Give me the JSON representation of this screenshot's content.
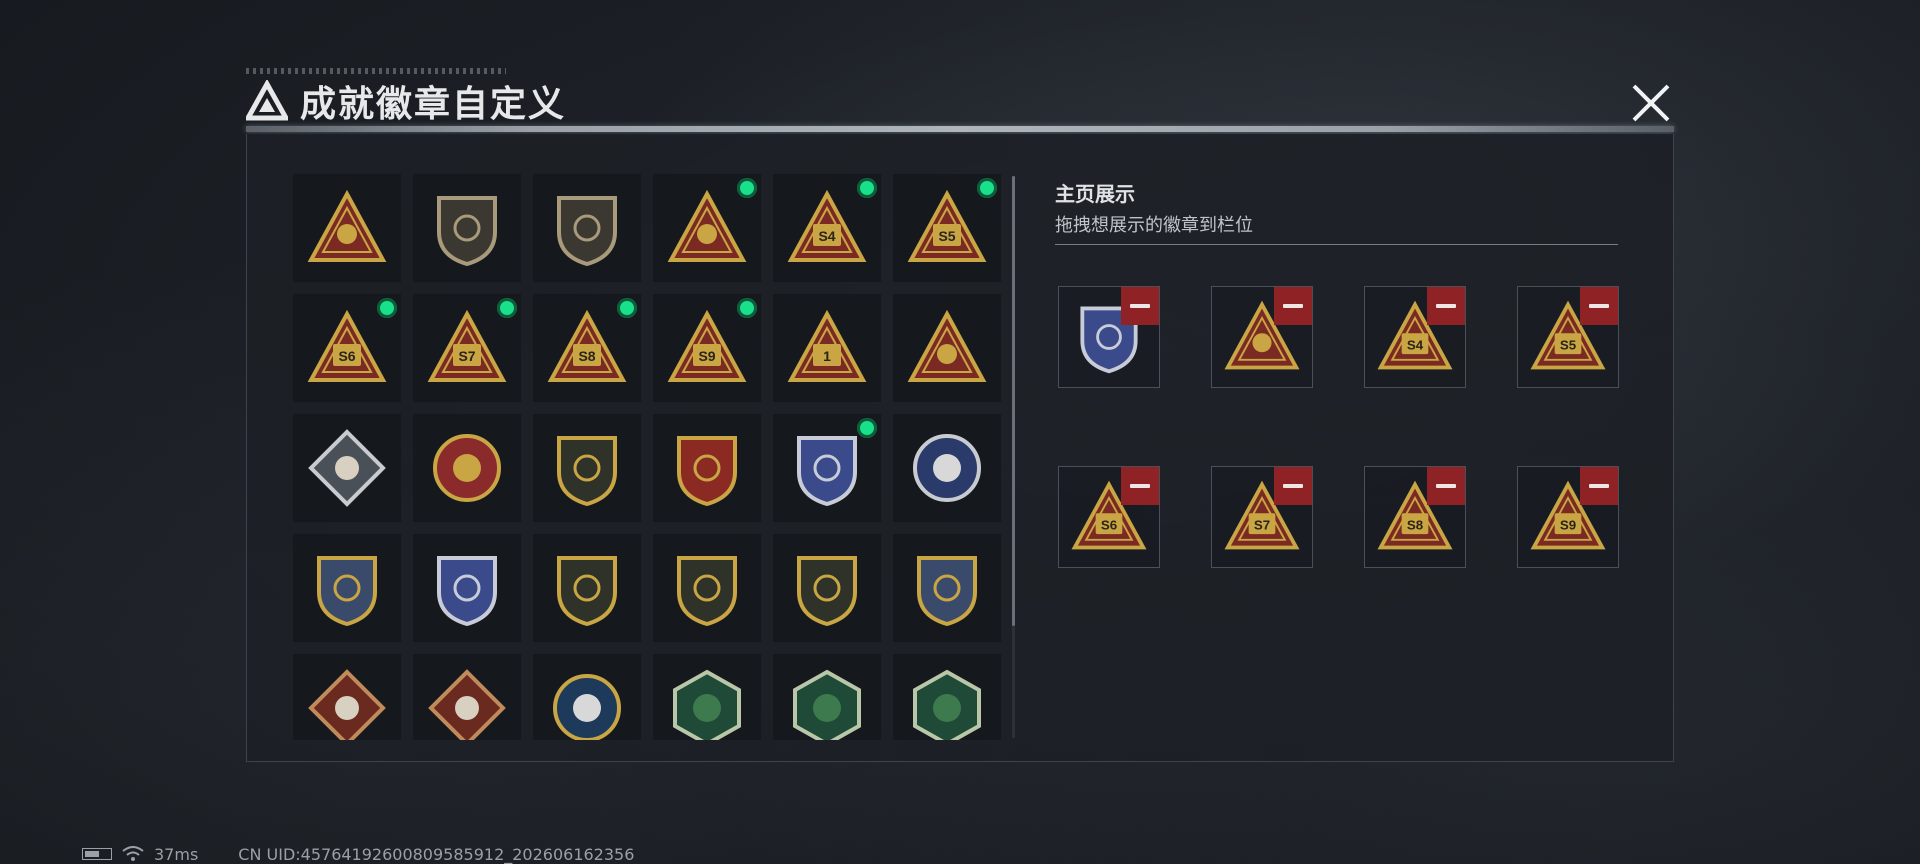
{
  "header": {
    "title": "成就徽章自定义"
  },
  "colors": {
    "accent_gold": "#c9a544",
    "brand_red": "#8f2225",
    "equipped_dot": "#19e08a",
    "badge_blue": "#3a4a8a"
  },
  "badge_library": {
    "rows": [
      [
        {
          "icon": "triangle-logo-shield-badge",
          "equipped": false
        },
        {
          "icon": "helicopter-shield-badge",
          "equipped": false
        },
        {
          "icon": "diamond-emblem-shield-badge",
          "equipped": false
        },
        {
          "icon": "radar-dish-triangle-badge",
          "equipped": true
        },
        {
          "icon": "season-4-triangle-badge",
          "label": "S4",
          "equipped": true
        },
        {
          "icon": "season-5-triangle-badge",
          "label": "S5",
          "equipped": true
        }
      ],
      [
        {
          "icon": "season-6-triangle-badge",
          "label": "S6",
          "equipped": true
        },
        {
          "icon": "season-7-triangle-badge",
          "label": "S7",
          "equipped": true
        },
        {
          "icon": "season-8-triangle-badge",
          "label": "S8",
          "equipped": true
        },
        {
          "icon": "season-9-triangle-badge",
          "label": "S9",
          "equipped": true
        },
        {
          "icon": "rank-one-triangle-badge",
          "label": "1",
          "equipped": false
        },
        {
          "icon": "soldiers-triangle-badge",
          "equipped": false
        }
      ],
      [
        {
          "icon": "rose-diamond-badge",
          "equipped": false
        },
        {
          "icon": "star-medal-badge",
          "equipped": false
        },
        {
          "icon": "gold-shield-badge",
          "equipped": false
        },
        {
          "icon": "laurel-shield-badge",
          "equipped": false
        },
        {
          "icon": "blue-diamond-shield-badge",
          "equipped": true
        },
        {
          "icon": "masked-face-round-badge",
          "equipped": false
        }
      ],
      [
        {
          "icon": "gold-crosshair-shield-badge",
          "equipped": false
        },
        {
          "icon": "blue-crosshair-shield-badge",
          "equipped": false
        },
        {
          "icon": "rifle-shield-badge",
          "equipped": false
        },
        {
          "icon": "smg-shield-badge",
          "equipped": false
        },
        {
          "icon": "shotgun-shield-badge",
          "equipped": false
        },
        {
          "icon": "gold-sniper-shield-badge",
          "equipped": false
        }
      ],
      [
        {
          "icon": "wolf-diamond-badge",
          "equipped": false
        },
        {
          "icon": "wolf-diamond-badge-2",
          "equipped": false
        },
        {
          "icon": "eagle-round-badge",
          "equipped": false
        },
        {
          "icon": "hornet-hexagon-badge",
          "equipped": false
        },
        {
          "icon": "hornet-hexagon-badge-2",
          "equipped": false
        },
        {
          "icon": "medic-hexagon-badge",
          "equipped": false
        }
      ]
    ]
  },
  "showcase": {
    "title": "主页展示",
    "subtitle": "拖拽想展示的徽章到栏位",
    "slots": [
      {
        "icon": "blue-diamond-shield-badge"
      },
      {
        "icon": "radar-dish-triangle-badge"
      },
      {
        "icon": "season-4-triangle-badge",
        "label": "S4"
      },
      {
        "icon": "season-5-triangle-badge",
        "label": "S5"
      },
      {
        "icon": "season-6-triangle-badge",
        "label": "S6"
      },
      {
        "icon": "season-7-triangle-badge",
        "label": "S7"
      },
      {
        "icon": "season-8-triangle-badge",
        "label": "S8"
      },
      {
        "icon": "season-9-triangle-badge",
        "label": "S9"
      }
    ]
  },
  "status_bar": {
    "ping": "37ms",
    "uid": "CN UID:45764192600809585912_202606162356"
  }
}
